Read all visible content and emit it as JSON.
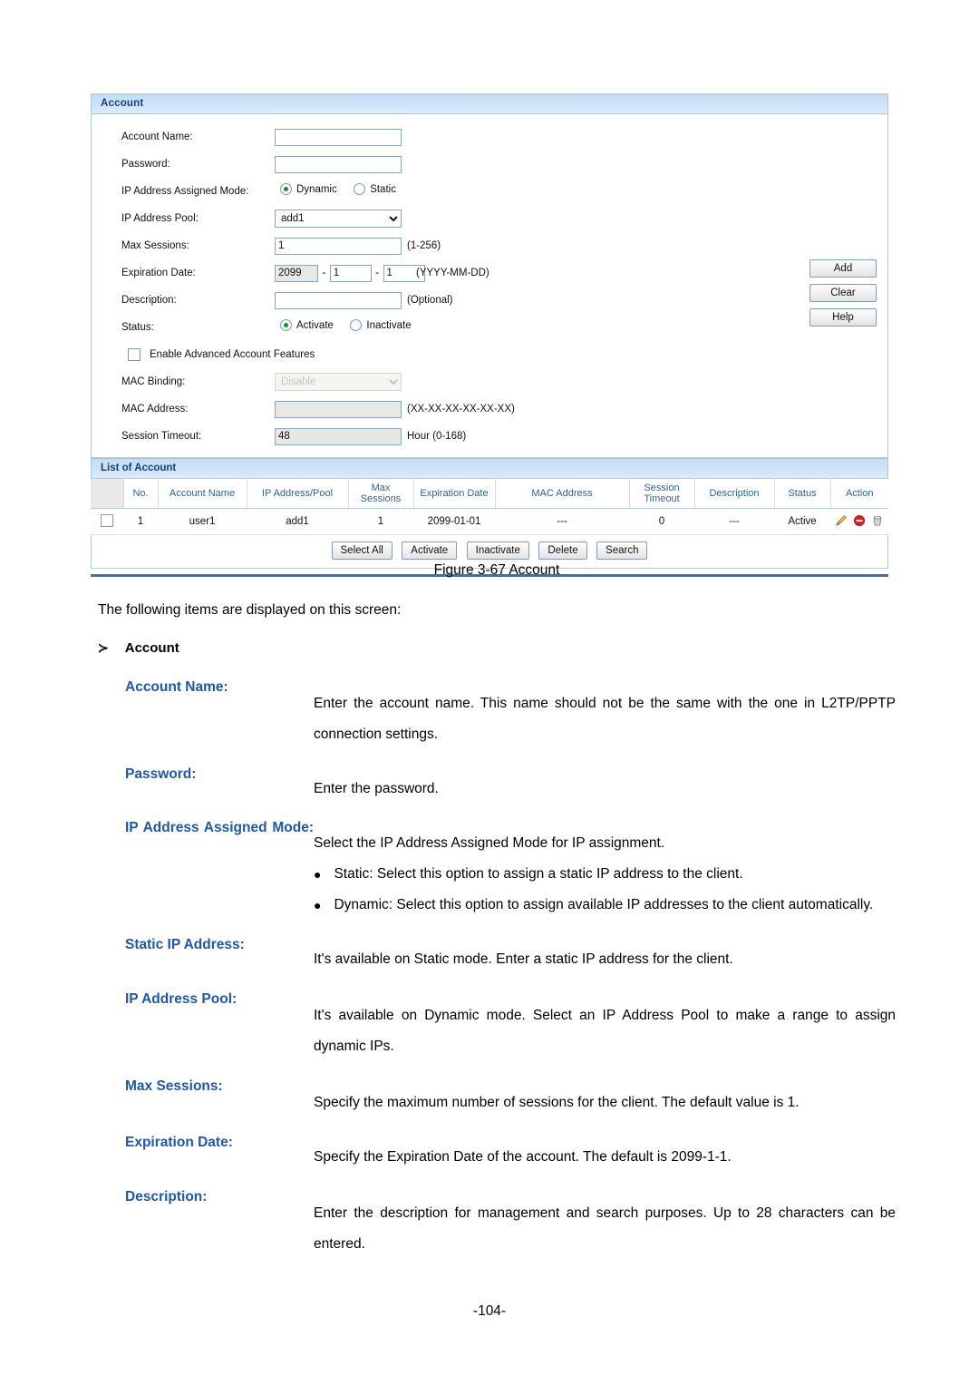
{
  "figure": {
    "panel_title": "Account",
    "form": {
      "account_name": {
        "label": "Account Name:",
        "value": ""
      },
      "password": {
        "label": "Password:",
        "value": ""
      },
      "ip_mode": {
        "label": "IP Address Assigned Mode:",
        "options": [
          "Dynamic",
          "Static"
        ],
        "selected": "Dynamic"
      },
      "ip_pool": {
        "label": "IP Address Pool:",
        "value": "add1",
        "options": [
          "add1"
        ]
      },
      "max_sessions": {
        "label": "Max Sessions:",
        "value": "1",
        "hint": "(1-256)"
      },
      "expiration_date": {
        "label": "Expiration Date:",
        "year": "2099",
        "month": "1",
        "day": "1",
        "sep": "-",
        "hint": "(YYYY-MM-DD)"
      },
      "description": {
        "label": "Description:",
        "value": "",
        "hint": "(Optional)"
      },
      "status": {
        "label": "Status:",
        "options": [
          "Activate",
          "Inactivate"
        ],
        "selected": "Activate"
      },
      "advanced": {
        "label": "Enable Advanced Account Features",
        "checked": false
      },
      "mac_binding": {
        "label": "MAC Binding:",
        "value": "Disable",
        "options": [
          "Disable"
        ],
        "disabled": true
      },
      "mac_address": {
        "label": "MAC Address:",
        "value": "",
        "hint": "(XX-XX-XX-XX-XX-XX)"
      },
      "session_timeout": {
        "label": "Session Timeout:",
        "value": "48",
        "hint": "Hour (0-168)"
      }
    },
    "side_buttons": [
      "Add",
      "Clear",
      "Help"
    ],
    "list": {
      "title": "List of Account",
      "columns": [
        "",
        "No.",
        "Account Name",
        "IP Address/Pool",
        "Max Sessions",
        "Expiration Date",
        "MAC Address",
        "Session Timeout",
        "Description",
        "Status",
        "Action"
      ],
      "rows": [
        {
          "no": "1",
          "account_name": "user1",
          "ip_address_pool": "add1",
          "max_sessions": "1",
          "expiration_date": "2099-01-01",
          "mac_address": "---",
          "session_timeout": "0",
          "description": "---",
          "status": "Active"
        }
      ]
    },
    "bottom_buttons": [
      "Select All",
      "Activate",
      "Inactivate",
      "Delete",
      "Search"
    ]
  },
  "document": {
    "figure_caption": "Figure 3-67 Account",
    "intro": "The following items are displayed on this screen:",
    "section_glyph": "≻",
    "section_title": "Account",
    "terms": [
      {
        "term": "Account Name:",
        "paragraphs": [
          "Enter the account name. This name should not be the same with the one in L2TP/PPTP connection settings."
        ]
      },
      {
        "term": "Password:",
        "paragraphs": [
          "Enter the password."
        ]
      },
      {
        "term": "IP Address Assigned Mode:",
        "paragraphs": [
          "Select the IP Address Assigned Mode for IP assignment."
        ],
        "bullets": [
          "Static: Select this option to assign a static IP address to the client.",
          "Dynamic: Select this option to assign available IP addresses to the client automatically."
        ]
      },
      {
        "term": "Static IP Address:",
        "paragraphs": [
          "It's available on Static mode. Enter a static IP address for the client."
        ]
      },
      {
        "term": "IP Address Pool:",
        "paragraphs": [
          "It's available on Dynamic mode. Select an IP Address Pool to make a range to assign dynamic IPs."
        ]
      },
      {
        "term": "Max Sessions:",
        "paragraphs": [
          "Specify the maximum number of sessions for the client. The default value is 1."
        ]
      },
      {
        "term": "Expiration Date:",
        "paragraphs": [
          "Specify the Expiration Date of the account. The default is 2099-1-1."
        ]
      },
      {
        "term": "Description:",
        "paragraphs": [
          "Enter the description for management and search purposes. Up to 28 characters can be entered."
        ]
      }
    ],
    "page_number": "-104-"
  },
  "colors": {
    "panel_header_bg": "#cfe3f7",
    "panel_header_text": "#19407c",
    "table_header_text": "#2f6296",
    "term_blue": "#1f58a6",
    "rule_blue": "#3573ac",
    "radio_dot_green": "#1a8f23"
  },
  "icons": {
    "edit": "pencil-icon",
    "disable": "block-icon",
    "delete": "trash-icon"
  }
}
